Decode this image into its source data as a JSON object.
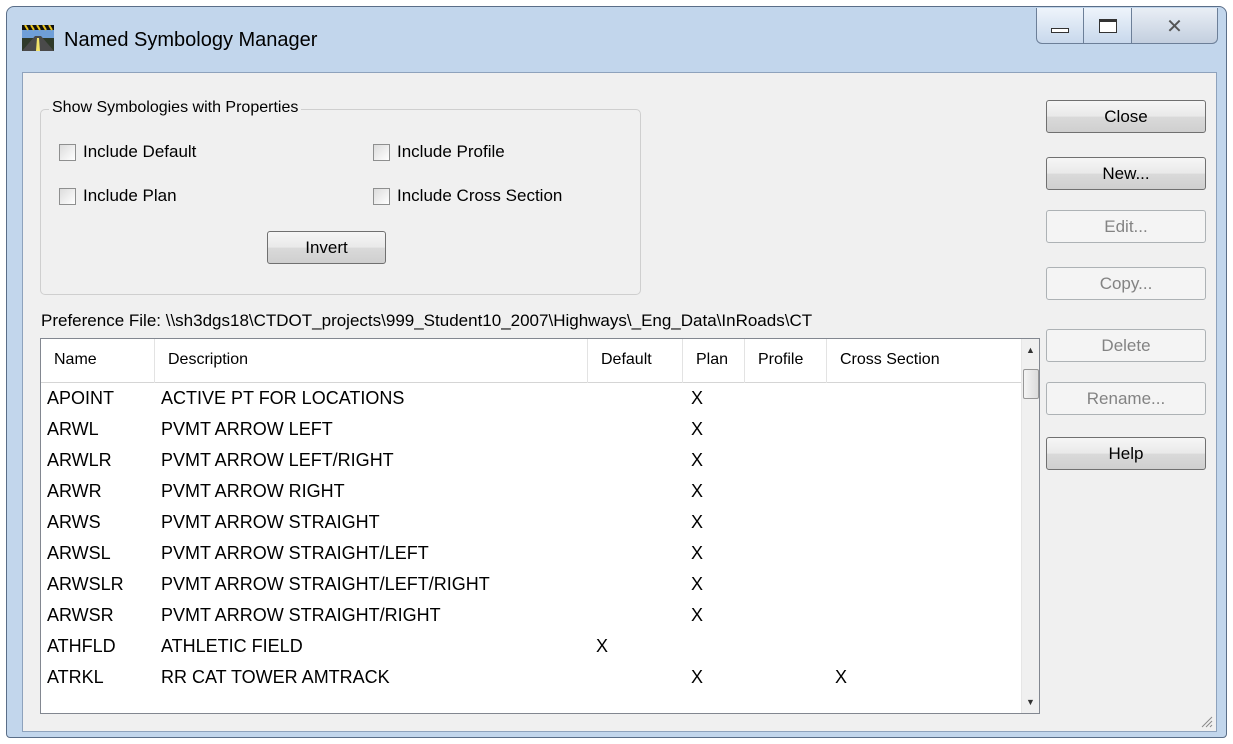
{
  "window": {
    "title": "Named Symbology Manager"
  },
  "group": {
    "legend": "Show Symbologies with Properties",
    "include_default": "Include Default",
    "include_profile": "Include Profile",
    "include_plan": "Include Plan",
    "include_cross_section": "Include Cross Section",
    "invert": "Invert"
  },
  "preference_file": "Preference File:  \\\\sh3dgs18\\CTDOT_projects\\999_Student10_2007\\Highways\\_Eng_Data\\InRoads\\CT",
  "buttons": {
    "close": "Close",
    "new": "New...",
    "edit": "Edit...",
    "copy": "Copy...",
    "delete": "Delete",
    "rename": "Rename...",
    "help": "Help"
  },
  "table": {
    "headers": {
      "name": "Name",
      "description": "Description",
      "default": "Default",
      "plan": "Plan",
      "profile": "Profile",
      "cross_section": "Cross Section"
    },
    "rows": [
      {
        "name": "APOINT",
        "description": "ACTIVE PT FOR LOCATIONS",
        "default": "",
        "plan": "X",
        "profile": "",
        "cross": ""
      },
      {
        "name": "ARWL",
        "description": "PVMT ARROW LEFT",
        "default": "",
        "plan": "X",
        "profile": "",
        "cross": ""
      },
      {
        "name": "ARWLR",
        "description": "PVMT ARROW LEFT/RIGHT",
        "default": "",
        "plan": "X",
        "profile": "",
        "cross": ""
      },
      {
        "name": "ARWR",
        "description": "PVMT ARROW RIGHT",
        "default": "",
        "plan": "X",
        "profile": "",
        "cross": ""
      },
      {
        "name": "ARWS",
        "description": "PVMT ARROW STRAIGHT",
        "default": "",
        "plan": "X",
        "profile": "",
        "cross": ""
      },
      {
        "name": "ARWSL",
        "description": "PVMT ARROW STRAIGHT/LEFT",
        "default": "",
        "plan": "X",
        "profile": "",
        "cross": ""
      },
      {
        "name": "ARWSLR",
        "description": "PVMT ARROW STRAIGHT/LEFT/RIGHT",
        "default": "",
        "plan": "X",
        "profile": "",
        "cross": ""
      },
      {
        "name": "ARWSR",
        "description": "PVMT ARROW STRAIGHT/RIGHT",
        "default": "",
        "plan": "X",
        "profile": "",
        "cross": ""
      },
      {
        "name": "ATHFLD",
        "description": "ATHLETIC FIELD",
        "default": "X",
        "plan": "",
        "profile": "",
        "cross": ""
      },
      {
        "name": "ATRKL",
        "description": "RR CAT TOWER AMTRACK",
        "default": "",
        "plan": "X",
        "profile": "",
        "cross": "X"
      }
    ]
  }
}
